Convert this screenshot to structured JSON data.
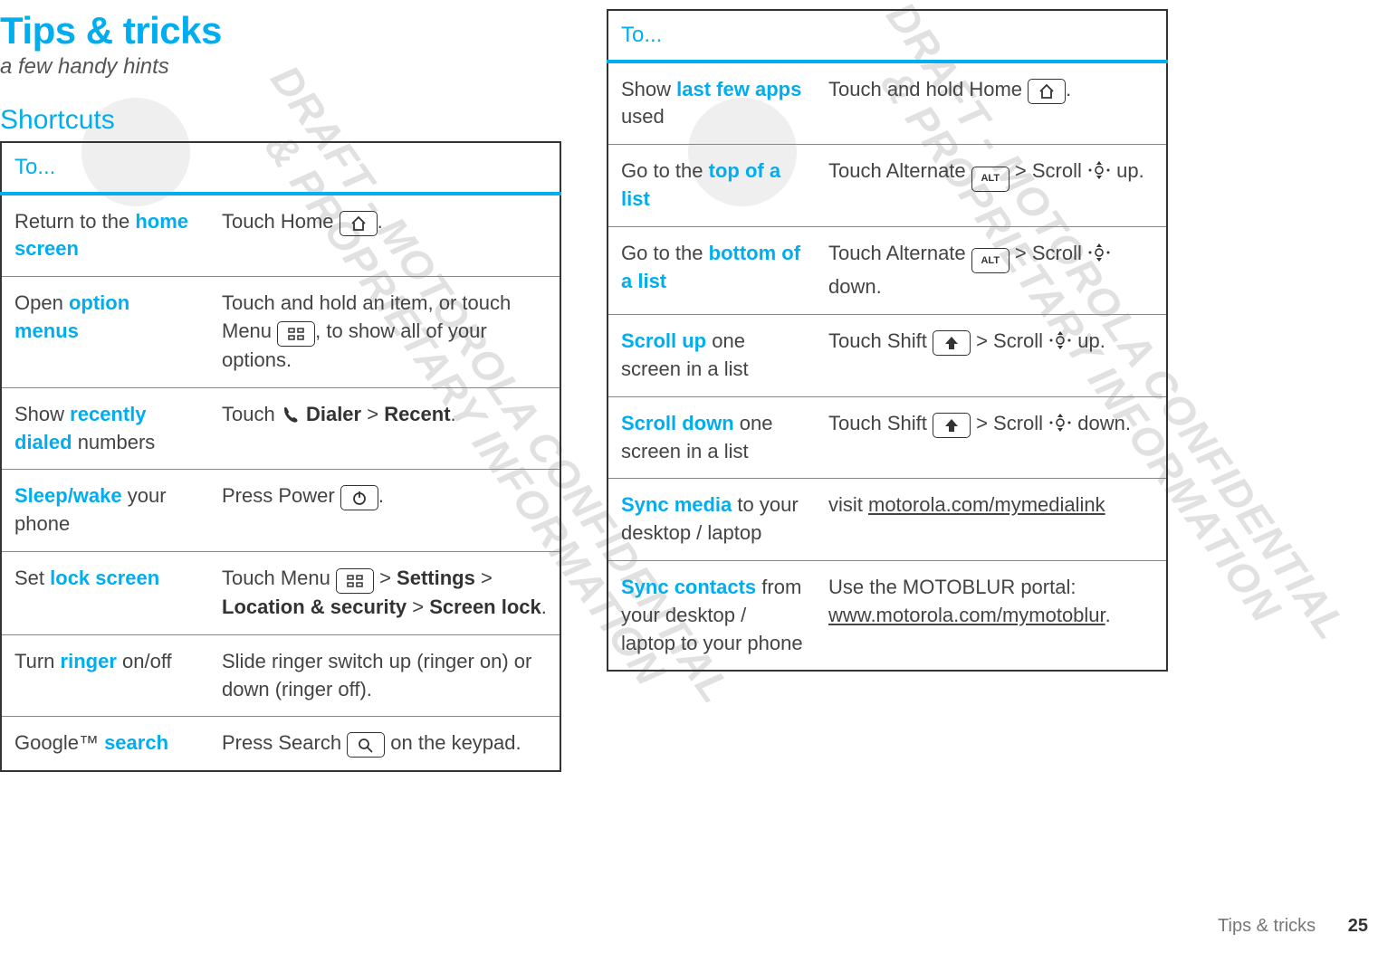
{
  "title": "Tips & tricks",
  "subtitle": "a few handy hints",
  "section_head": "Shortcuts",
  "table_header": "To...",
  "footer_text": "Tips & tricks",
  "page_number": "25",
  "watermark_lines": "DRAFT - MOTOROLA CONFIDENTIAL\n& PROPRIETARY INFORMATION",
  "keys": {
    "alt": "ALT"
  },
  "left_rows": [
    {
      "left_pre": "Return to the ",
      "left_hl": "home screen",
      "left_post": "",
      "right_pre": "Touch Home ",
      "right_icons": [
        "home"
      ],
      "right_post": "."
    },
    {
      "left_pre": "Open ",
      "left_hl": "option menus",
      "left_post": "",
      "right_pre": "Touch and hold an item, or touch Menu ",
      "right_icons": [
        "menu"
      ],
      "right_post": ", to show all of your options."
    },
    {
      "left_pre": "Show ",
      "left_hl": "recently dialed",
      "left_post": " numbers",
      "right_html": "Touch <PHONE> <b>Dialer</b> > <b>Recent</b>."
    },
    {
      "left_hl": "Sleep/wake",
      "left_post": " your phone",
      "right_pre": "Press Power ",
      "right_icons": [
        "power"
      ],
      "right_post": "."
    },
    {
      "left_pre": "Set ",
      "left_hl": "lock screen",
      "left_post": "",
      "right_html": "Touch Menu <MENU> > <b>Settings</b> > <b>Location & security</b> > <b>Screen lock</b>."
    },
    {
      "left_pre": "Turn ",
      "left_hl": "ringer",
      "left_post": " on/off",
      "right_plain": "Slide ringer switch up (ringer on) or down (ringer off)."
    },
    {
      "left_pre": "Google™ ",
      "left_hl": "search",
      "left_post": "",
      "right_pre": "Press Search ",
      "right_icons": [
        "search"
      ],
      "right_post": " on the keypad."
    }
  ],
  "right_rows": [
    {
      "left_pre": "Show ",
      "left_hl": "last few apps",
      "left_post": " used",
      "right_pre": "Touch and hold Home ",
      "right_icons": [
        "home"
      ],
      "right_post": "."
    },
    {
      "left_pre": "Go to the ",
      "left_hl": "top of a list",
      "left_post": "",
      "right_html": "Touch Alternate <ALT> > Scroll <SCROLL> up."
    },
    {
      "left_pre": "Go to the ",
      "left_hl": "bottom of a list",
      "left_post": "",
      "right_html": "Touch Alternate <ALT> > Scroll <SCROLL> down."
    },
    {
      "left_hl": "Scroll up",
      "left_post": " one screen in a list",
      "right_html": "Touch Shift <SHIFT> > Scroll <SCROLL> up."
    },
    {
      "left_hl": "Scroll down",
      "left_post": " one screen in a list",
      "right_html": "Touch Shift <SHIFT> > Scroll <SCROLL> down."
    },
    {
      "left_hl": "Sync media",
      "left_post": " to your desktop / laptop",
      "right_html": "visit <u>motorola.com/mymedialink</u>"
    },
    {
      "left_hl": "Sync contacts",
      "left_post": " from your desktop / laptop to your phone",
      "right_html": "Use the MOTOBLUR portal: <u>www.motorola.com/mymotoblur</u>."
    }
  ]
}
